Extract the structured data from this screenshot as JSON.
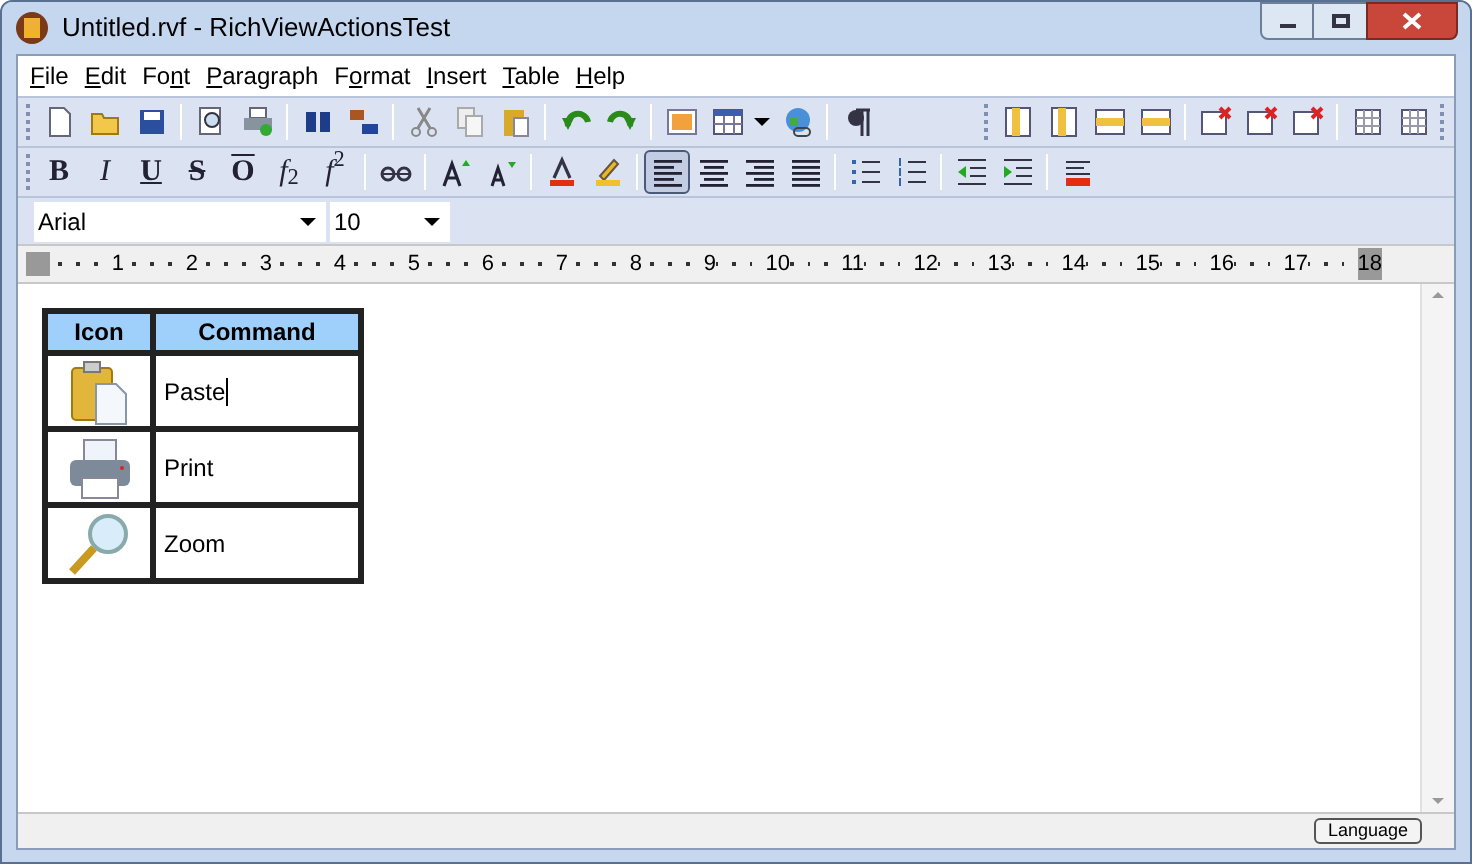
{
  "window": {
    "title": "Untitled.rvf - RichViewActionsTest"
  },
  "menu": [
    {
      "key": "F",
      "after": "ile"
    },
    {
      "key": "E",
      "after": "dit"
    },
    {
      "before": "Fo",
      "key": "n",
      "after": "t"
    },
    {
      "key": "P",
      "after": "aragraph"
    },
    {
      "before": "F",
      "key": "o",
      "after": "rmat"
    },
    {
      "key": "I",
      "after": "nsert"
    },
    {
      "key": "T",
      "after": "able"
    },
    {
      "key": "H",
      "after": "elp"
    }
  ],
  "format_buttons": [
    {
      "kind": "bold",
      "glyph": "B"
    },
    {
      "kind": "italic",
      "glyph": "I"
    },
    {
      "kind": "underline",
      "glyph": "U"
    },
    {
      "kind": "strike",
      "glyph": "S"
    },
    {
      "kind": "overline",
      "glyph": "O"
    },
    {
      "kind": "script",
      "glyph": "*f*$_{2}$"
    },
    {
      "kind": "script",
      "glyph": "*f*$^{2}$"
    }
  ],
  "alignment": [
    {
      "selected": true
    },
    {
      "selected": false
    },
    {
      "selected": false
    },
    {
      "selected": false
    }
  ],
  "font_name": "Arial",
  "font_size": "10",
  "ruler": [
    "1",
    "2",
    "3",
    "4",
    "5",
    "6",
    "7",
    "8",
    "9",
    "10",
    "11",
    "12",
    "13",
    "14",
    "15",
    "16",
    "17",
    "18"
  ],
  "table": {
    "columns": [
      "Icon",
      "Command"
    ],
    "rows": [
      {
        "command": "Paste",
        "caret": true
      },
      {
        "command": "Print",
        "caret": false
      },
      {
        "command": "Zoom",
        "caret": false
      }
    ]
  },
  "status_bar": {
    "button": "Language"
  }
}
